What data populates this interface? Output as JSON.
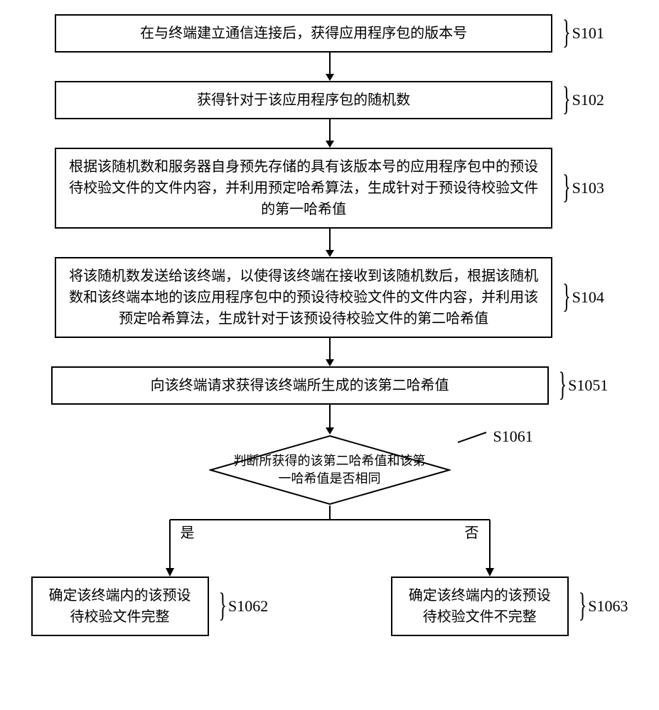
{
  "steps": {
    "s101": {
      "text": "在与终端建立通信连接后，获得应用程序包的版本号",
      "label": "S101"
    },
    "s102": {
      "text": "获得针对于该应用程序包的随机数",
      "label": "S102"
    },
    "s103": {
      "text": "根据该随机数和服务器自身预先存储的具有该版本号的应用程序包中的预设待校验文件的文件内容，并利用预定哈希算法，生成针对于预设待校验文件的第一哈希值",
      "label": "S103"
    },
    "s104": {
      "text": "将该随机数发送给该终端，以使得该终端在接收到该随机数后，根据该随机数和该终端本地的该应用程序包中的预设待校验文件的文件内容，并利用该预定哈希算法，生成针对于该预设待校验文件的第二哈希值",
      "label": "S104"
    },
    "s1051": {
      "text": "向该终端请求获得该终端所生成的该第二哈希值",
      "label": "S1051"
    },
    "s1061": {
      "text": "判断所获得的该第二哈希值和该第一哈希值是否相同",
      "label": "S1061"
    },
    "s1062": {
      "text": "确定该终端内的该预设待校验文件完整",
      "label": "S1062"
    },
    "s1063": {
      "text": "确定该终端内的该预设待校验文件不完整",
      "label": "S1063"
    }
  },
  "branch": {
    "yes": "是",
    "no": "否"
  }
}
